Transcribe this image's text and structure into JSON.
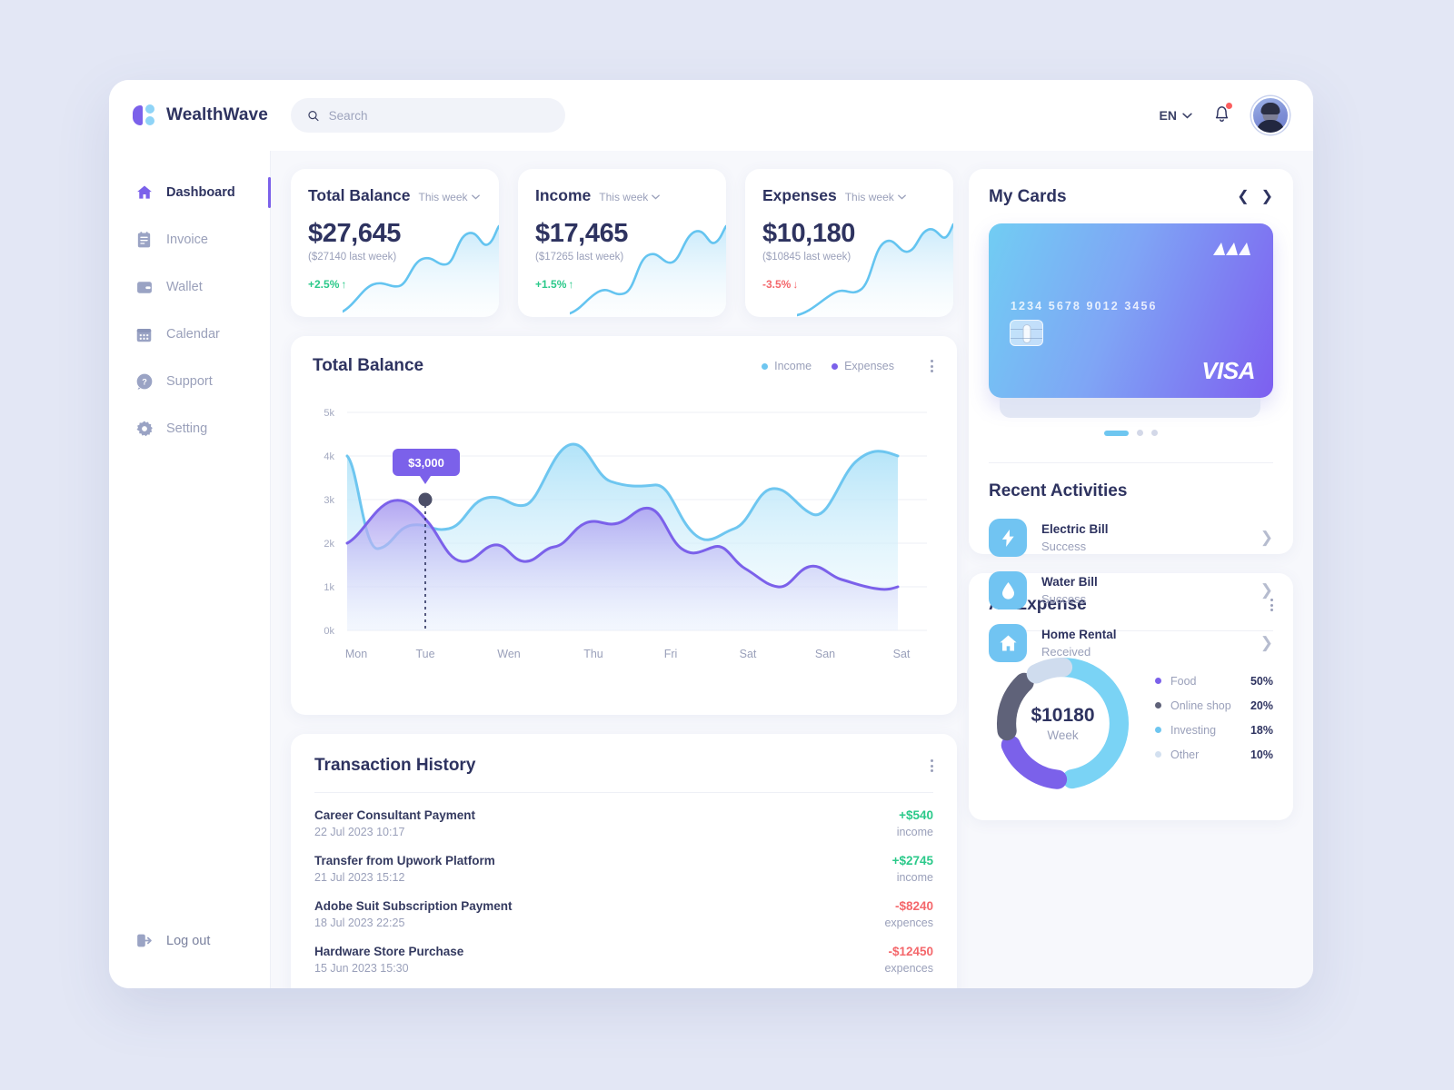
{
  "brand": {
    "name": "WealthWave"
  },
  "search": {
    "placeholder": "Search",
    "value": ""
  },
  "header": {
    "language": "EN"
  },
  "sidebar": {
    "items": [
      {
        "label": "Dashboard",
        "icon": "home-icon",
        "active": true
      },
      {
        "label": "Invoice",
        "icon": "invoice-icon",
        "active": false
      },
      {
        "label": "Wallet",
        "icon": "wallet-icon",
        "active": false
      },
      {
        "label": "Calendar",
        "icon": "calendar-icon",
        "active": false
      },
      {
        "label": "Support",
        "icon": "help-icon",
        "active": false
      },
      {
        "label": "Setting",
        "icon": "gear-icon",
        "active": false
      }
    ],
    "logout": {
      "label": "Log out",
      "icon": "logout-icon"
    }
  },
  "stats": [
    {
      "title": "Total Balance",
      "period": "This week",
      "value": "$27,645",
      "last": "($27140 last week)",
      "delta": "+2.5%",
      "direction": "up"
    },
    {
      "title": "Income",
      "period": "This week",
      "value": "$17,465",
      "last": "($17265 last week)",
      "delta": "+1.5%",
      "direction": "up"
    },
    {
      "title": "Expenses",
      "period": "This week",
      "value": "$10,180",
      "last": "($10845 last week)",
      "delta": "-3.5%",
      "direction": "down"
    }
  ],
  "big_chart": {
    "title": "Total Balance",
    "legend": [
      {
        "label": "Income",
        "color": "#6ec6f0"
      },
      {
        "label": "Expenses",
        "color": "#7b61ea"
      }
    ],
    "tooltip": "$3,000"
  },
  "chart_data": {
    "type": "area",
    "title": "Total Balance",
    "xlabel": "",
    "ylabel": "",
    "categories": [
      "Mon",
      "Tue",
      "Wen",
      "Thu",
      "Fri",
      "Sat",
      "San",
      "Sat"
    ],
    "ytick_labels": [
      "0k",
      "1k",
      "2k",
      "3k",
      "4k",
      "5k"
    ],
    "ylim": [
      0,
      5000
    ],
    "grid": true,
    "legend_position": "top-right",
    "annotation": {
      "label": "$3,000",
      "x": "Tue",
      "y": 3000
    },
    "series": [
      {
        "name": "Income",
        "color": "#6ec6f0",
        "values": [
          4000,
          1900,
          2400,
          2850,
          4200,
          3200,
          2200,
          4000
        ]
      },
      {
        "name": "Expenses",
        "color": "#7b61ea",
        "values": [
          2000,
          3000,
          1650,
          1750,
          2500,
          1900,
          800,
          1000
        ]
      }
    ]
  },
  "transactions": {
    "title": "Transaction History",
    "rows": [
      {
        "name": "Career Consultant Payment",
        "date": "22 Jul 2023 10:17",
        "amount": "+$540",
        "kind": "income",
        "type": "inc"
      },
      {
        "name": "Transfer from Upwork Platform",
        "date": "21 Jul 2023 15:12",
        "amount": "+$2745",
        "kind": "income",
        "type": "inc"
      },
      {
        "name": "Adobe Suit Subscription Payment",
        "date": "18 Jul 2023 22:25",
        "amount": "-$8240",
        "kind": "expences",
        "type": "exp"
      },
      {
        "name": "Hardware Store Purchase",
        "date": "15 Jun 2023 15:30",
        "amount": "-$12450",
        "kind": "expences",
        "type": "exp"
      }
    ]
  },
  "my_cards": {
    "title": "My Cards",
    "card": {
      "number": "1234 5678 9012 3456",
      "network": "VISA"
    },
    "pagination": {
      "active": 0,
      "total": 3
    }
  },
  "recent_activities": {
    "title": "Recent Activities",
    "items": [
      {
        "name": "Electric Bill",
        "status": "Success",
        "icon": "bolt-icon"
      },
      {
        "name": "Water Bill",
        "status": "Success",
        "icon": "droplet-icon"
      },
      {
        "name": "Home Rental",
        "status": "Received",
        "icon": "home-icon"
      }
    ]
  },
  "all_expense": {
    "title": "All Expense",
    "center_amount": "$10180",
    "center_label": "Week",
    "chart_data": {
      "type": "pie",
      "title": "All Expense",
      "categories": [
        "Food",
        "Online shop",
        "Investing",
        "Other"
      ],
      "values": [
        50,
        20,
        18,
        10
      ],
      "value_labels": [
        "50%",
        "20%",
        "18%",
        "10%"
      ],
      "legend_colors": [
        "#7b61ea",
        "#5f6279",
        "#6ec6f0",
        "#d3e0f0"
      ],
      "segment_colors": [
        "#7ad3f5",
        "#7b61ea",
        "#5f6279",
        "#cfdcee"
      ]
    }
  }
}
